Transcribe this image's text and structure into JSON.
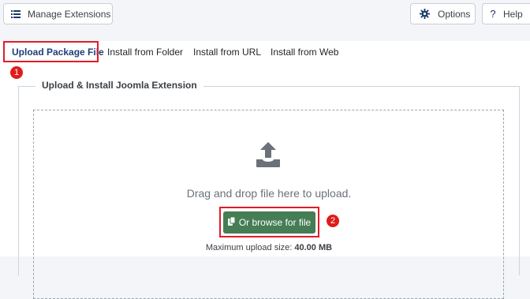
{
  "toolbar": {
    "manage_label": "Manage Extensions",
    "options_label": "Options",
    "help_label": "Help",
    "help_glyph": "?"
  },
  "tabs": [
    {
      "label": "Upload Package File",
      "active": true
    },
    {
      "label": "Install from Folder",
      "active": false
    },
    {
      "label": "Install from URL",
      "active": false
    },
    {
      "label": "Install from Web",
      "active": false
    }
  ],
  "annotations": {
    "badge1": "1",
    "badge2": "2"
  },
  "upload": {
    "legend": "Upload & Install Joomla Extension",
    "drag_text": "Drag and drop file here to upload.",
    "browse_label": "Or browse for file",
    "max_label": "Maximum upload size:",
    "max_value": "40.00 MB"
  },
  "colors": {
    "accent": "#1f3e77",
    "browse_button": "#457d54",
    "highlight": "#e11d26"
  },
  "icons": [
    "list-icon",
    "gear-icon",
    "question-icon",
    "upload-icon",
    "copy-icon"
  ]
}
